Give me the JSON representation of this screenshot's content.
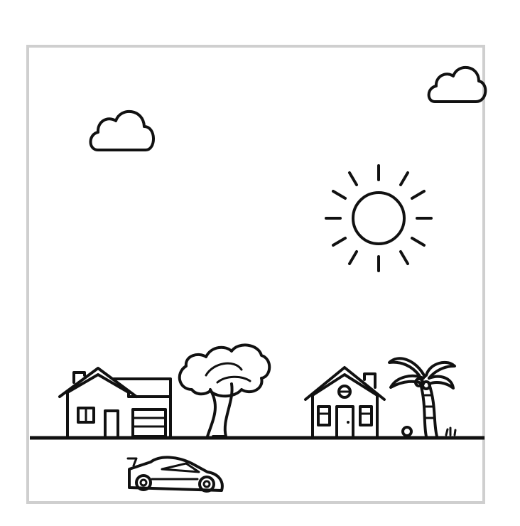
{
  "scene": {
    "frame_color": "#cfcfcf",
    "ink_color": "#111111",
    "background": "#ffffff",
    "icons": [
      "cloud-icon",
      "cloud-icon",
      "sun-icon",
      "house-with-garage-icon",
      "tree-icon",
      "house-icon",
      "palm-tree-icon",
      "race-car-icon",
      "ground-line"
    ]
  }
}
